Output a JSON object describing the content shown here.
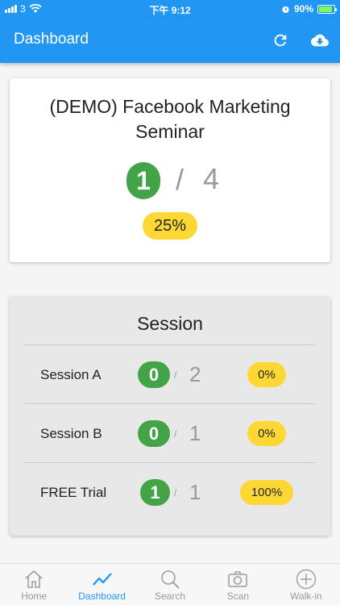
{
  "status": {
    "carrier": "3",
    "time": "下午 9:12",
    "battery": "90%",
    "battery_level": 0.9
  },
  "appbar": {
    "title": "Dashboard",
    "refresh_icon": "refresh-icon",
    "download_icon": "cloud-download-icon"
  },
  "event": {
    "title": "(DEMO) Facebook Marketing Seminar",
    "checked_in": "1",
    "slash": "/",
    "total": "4",
    "percent": "25%"
  },
  "session": {
    "header": "Session",
    "rows": [
      {
        "name": "Session A",
        "checked_in": "0",
        "slash": "/",
        "total": "2",
        "percent": "0%"
      },
      {
        "name": "Session B",
        "checked_in": "0",
        "slash": "/",
        "total": "1",
        "percent": "0%"
      },
      {
        "name": "FREE Trial",
        "checked_in": "1",
        "slash": "/",
        "total": "1",
        "percent": "100%"
      }
    ]
  },
  "tabs": [
    {
      "label": "Home",
      "icon": "home-icon"
    },
    {
      "label": "Dashboard",
      "icon": "trend-icon",
      "active": true
    },
    {
      "label": "Search",
      "icon": "search-icon"
    },
    {
      "label": "Scan",
      "icon": "camera-icon"
    },
    {
      "label": "Walk-in",
      "icon": "add-circle-icon"
    }
  ],
  "colors": {
    "primary": "#2196f3",
    "green": "#43a447",
    "yellow": "#fdd835"
  }
}
